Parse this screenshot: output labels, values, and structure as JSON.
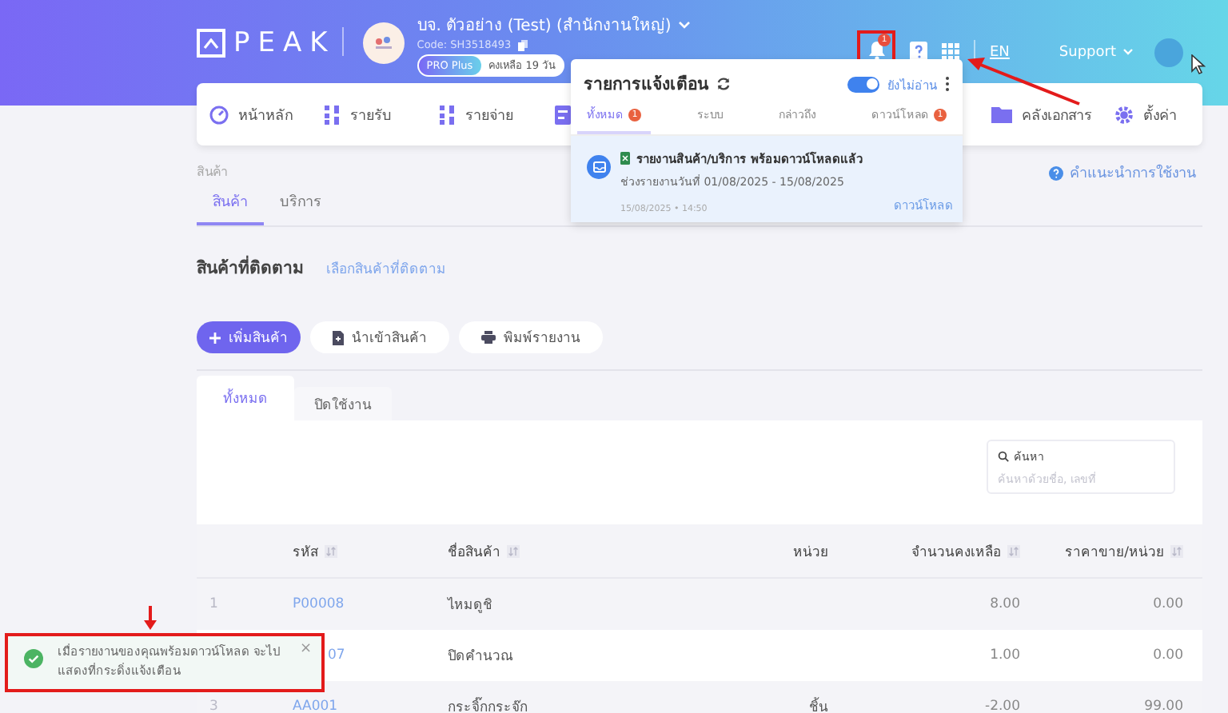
{
  "header": {
    "logo": "PEAK",
    "company": "บจ. ตัวอย่าง (Test) (สำนักงานใหญ่)",
    "code": "Code: SH3518493",
    "plan": "PRO Plus",
    "remaining": "คงเหลือ 19 วัน",
    "bell_badge": "1",
    "language": "EN",
    "support": "Support"
  },
  "nav": [
    {
      "label": "หน้าหลัก"
    },
    {
      "label": "รายรับ"
    },
    {
      "label": "รายจ่าย"
    },
    {
      "label": "คลังเอกสาร"
    },
    {
      "label": "ตั้งค่า"
    }
  ],
  "notifications": {
    "title": "รายการแจ้งเตือน",
    "unread_only": true,
    "unread_label": "ยังไม่อ่าน",
    "tabs": [
      {
        "label": "ทั้งหมด",
        "selected": true,
        "badge": "1"
      },
      {
        "label": "ระบบ",
        "selected": false
      },
      {
        "label": "กล่าวถึง",
        "selected": false
      },
      {
        "label": "ดาวน์โหลด",
        "selected": false,
        "badge": "1"
      }
    ],
    "items": [
      {
        "title": "รายงานสินค้า/บริการ พร้อมดาวน์โหลดแล้ว",
        "detail": "ช่วงรายงานวันที่ 01/08/2025 - 15/08/2025",
        "time": "15/08/2025 • 14:50",
        "action": "ดาวน์โหลด",
        "unread": true
      }
    ]
  },
  "breadcrumb": "สินค้า",
  "help": "คำแนะนำการใช้งาน",
  "tabs": [
    {
      "label": "สินค้า",
      "selected": true
    },
    {
      "label": "บริการ",
      "selected": false
    }
  ],
  "section": {
    "title": "สินค้าที่ติดตาม",
    "link": "เลือกสินค้าที่ติดตาม"
  },
  "buttons": [
    {
      "label": "เพิ่มสินค้า",
      "kind": "primary"
    },
    {
      "label": "นำเข้าสินค้า",
      "kind": "import"
    },
    {
      "label": "พิมพ์รายงาน",
      "kind": "print"
    }
  ],
  "table_tabs": [
    {
      "label": "ทั้งหมด",
      "selected": true
    },
    {
      "label": "ปิดใช้งาน",
      "selected": false
    }
  ],
  "search": {
    "label": "ค้นหา",
    "placeholder": "ค้นหาด้วยชื่อ, เลขที่"
  },
  "table": {
    "columns": [
      {
        "label": "รหัส",
        "sortable": true
      },
      {
        "label": "ชื่อสินค้า",
        "sortable": true
      },
      {
        "label": "หน่วย",
        "sortable": false
      },
      {
        "label": "จำนวนคงเหลือ",
        "sortable": true
      },
      {
        "label": "ราคาขาย/หน่วย",
        "sortable": true
      }
    ],
    "rows": [
      {
        "index": "1",
        "code": "P00008",
        "name": "ไหมดูชิ",
        "qty": "8.00",
        "price": "0.00"
      },
      {
        "code": "07",
        "covered": true,
        "name": "ปิดคำนวณ",
        "qty": "1.00",
        "price": "0.00"
      },
      {
        "index": "3",
        "code": "AA001",
        "name": "กระจิ๊กกระจ๊ก",
        "unit": "ชิ้น",
        "qty": "-2.00",
        "price": "99.00"
      }
    ]
  },
  "toast": {
    "message": "เมื่อรายงานของคุณพร้อมดาวน์โหลด จะไปแสดงที่กระดิ่งแจ้งเตือน",
    "close": "×"
  }
}
